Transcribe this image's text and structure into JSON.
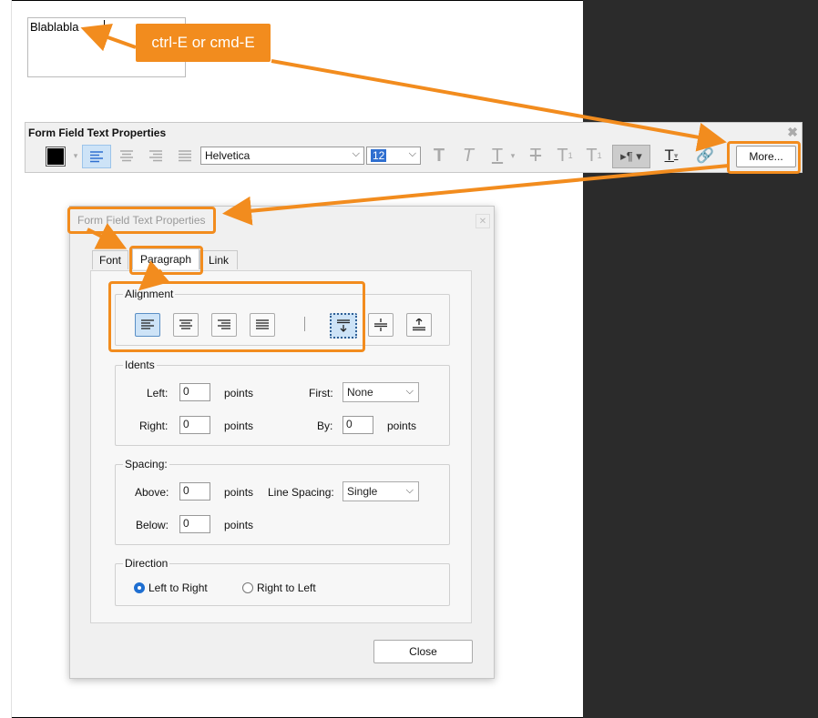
{
  "canvas": {
    "field_text": "Blablabla"
  },
  "callout": {
    "text": "ctrl-E or cmd-E"
  },
  "toolbar": {
    "title": "Form Field Text Properties",
    "font_name": "Helvetica",
    "font_size": "12",
    "more_label": "More..."
  },
  "dialog": {
    "title": "Form Field Text Properties",
    "tabs": [
      "Font",
      "Paragraph",
      "Link"
    ],
    "alignment": {
      "label": "Alignment",
      "selected": "left",
      "vertical_selected": "top"
    },
    "indents": {
      "label": "Idents",
      "left_label": "Left:",
      "left_value": "0",
      "right_label": "Right:",
      "right_value": "0",
      "first_label": "First:",
      "first_value": "None",
      "by_label": "By:",
      "by_value": "0",
      "unit": "points"
    },
    "spacing": {
      "label": "Spacing:",
      "above_label": "Above:",
      "above_value": "0",
      "below_label": "Below:",
      "below_value": "0",
      "line_spacing_label": "Line Spacing:",
      "line_spacing_value": "Single",
      "unit": "points"
    },
    "direction": {
      "label": "Direction",
      "ltr_label": "Left to Right",
      "rtl_label": "Right to Left",
      "selected": "ltr"
    },
    "close_label": "Close"
  },
  "colors": {
    "accent_orange": "#f28c1e",
    "selection_blue": "#cde3f7"
  }
}
